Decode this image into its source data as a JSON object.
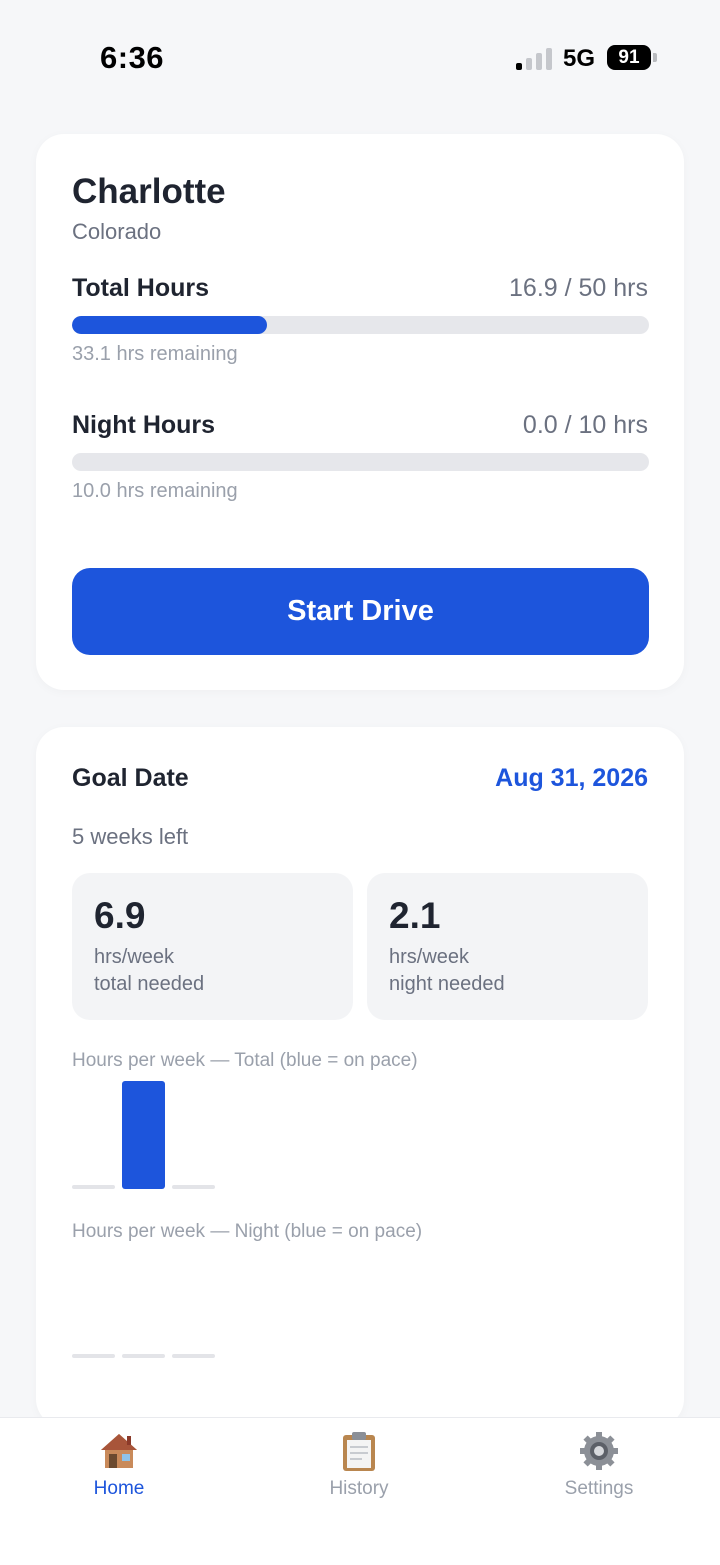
{
  "status_bar": {
    "time": "6:36",
    "network": "5G",
    "battery": "91"
  },
  "learner": {
    "name": "Charlotte",
    "state": "Colorado"
  },
  "progress": {
    "total": {
      "label": "Total Hours",
      "value_text": "16.9 / 50 hrs",
      "fraction": 0.338,
      "remaining_text": "33.1 hrs remaining"
    },
    "night": {
      "label": "Night Hours",
      "value_text": "0.0 / 10 hrs",
      "fraction": 0.0,
      "remaining_text": "10.0 hrs remaining"
    }
  },
  "start_button_label": "Start Drive",
  "goal": {
    "label": "Goal Date",
    "date": "Aug 31, 2026",
    "weeks_left": "5 weeks left",
    "total_needed": {
      "number": "6.9",
      "unit": "hrs/week",
      "desc": "total needed"
    },
    "night_needed": {
      "number": "2.1",
      "unit": "hrs/week",
      "desc": "night needed"
    }
  },
  "charts": {
    "total_caption": "Hours per week — Total (blue = on pace)",
    "night_caption": "Hours per week — Night (blue = on pace)"
  },
  "chart_data": [
    {
      "type": "bar",
      "categories": [
        "",
        "",
        ""
      ],
      "values": [
        0.0,
        16.9,
        0.0
      ],
      "on_pace": [
        false,
        true,
        false
      ],
      "colors": {
        "on_pace": "#1d55dc",
        "off_pace": "#e3e4e8"
      }
    },
    {
      "type": "bar",
      "categories": [
        "",
        "",
        ""
      ],
      "values": [
        0.0,
        0.0,
        0.0
      ],
      "on_pace": [
        false,
        false,
        false
      ],
      "colors": {
        "on_pace": "#1d55dc",
        "off_pace": "#e3e4e8"
      }
    }
  ],
  "tabs": [
    {
      "label": "Home",
      "icon": "house-icon",
      "active": true
    },
    {
      "label": "History",
      "icon": "clipboard-icon",
      "active": false
    },
    {
      "label": "Settings",
      "icon": "gear-icon",
      "active": false
    }
  ],
  "colors": {
    "accent": "#1d55dc",
    "track": "#e6e7eb"
  }
}
